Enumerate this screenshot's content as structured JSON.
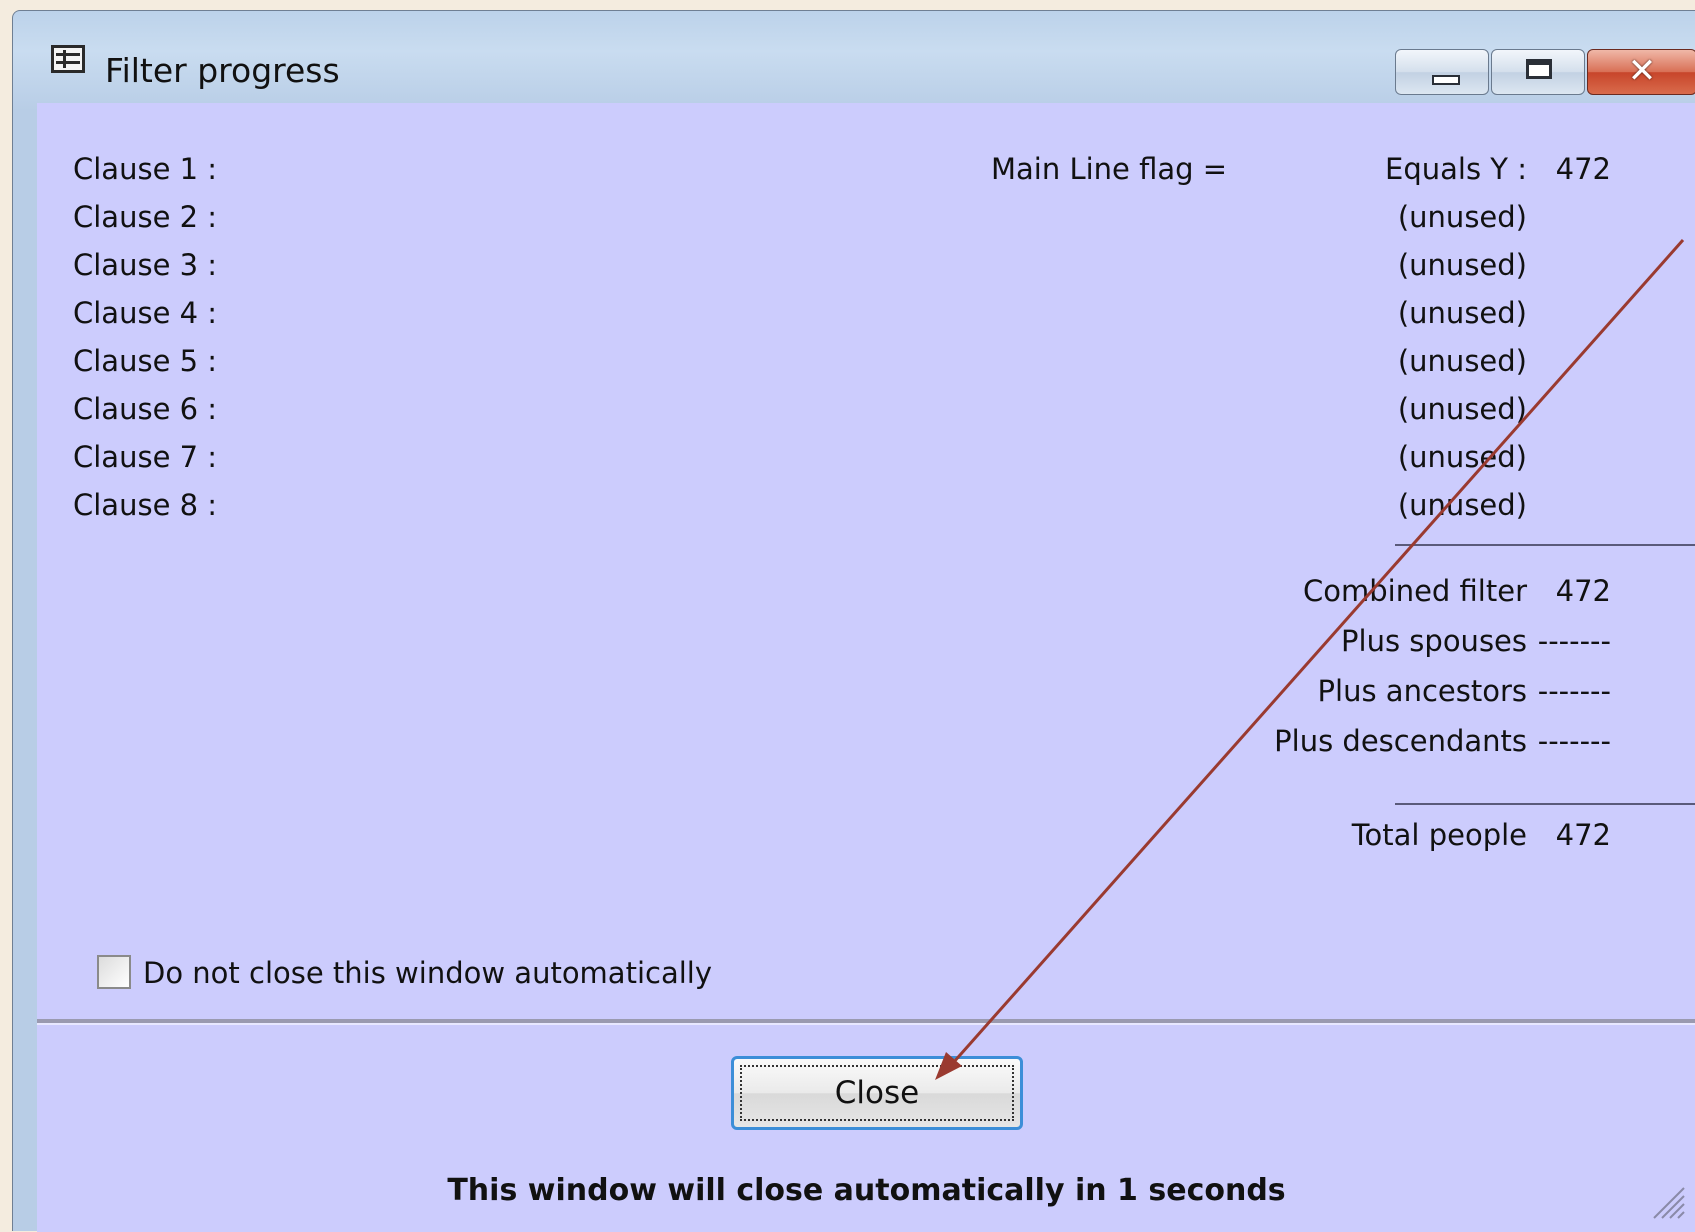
{
  "window": {
    "title": "Filter progress",
    "icon": "filter-window-icon",
    "controls": [
      "minimize-icon",
      "maximize-icon",
      "close-icon"
    ]
  },
  "clauses": [
    {
      "label": "Clause 1 :",
      "field": "Main Line flag =",
      "value": "Equals Y :",
      "count": "472"
    },
    {
      "label": "Clause 2 :",
      "field": "",
      "value": "(unused)",
      "count": ""
    },
    {
      "label": "Clause 3 :",
      "field": "",
      "value": "(unused)",
      "count": ""
    },
    {
      "label": "Clause 4 :",
      "field": "",
      "value": "(unused)",
      "count": ""
    },
    {
      "label": "Clause 5 :",
      "field": "",
      "value": "(unused)",
      "count": ""
    },
    {
      "label": "Clause 6 :",
      "field": "",
      "value": "(unused)",
      "count": ""
    },
    {
      "label": "Clause 7 :",
      "field": "",
      "value": "(unused)",
      "count": ""
    },
    {
      "label": "Clause 8 :",
      "field": "",
      "value": "(unused)",
      "count": ""
    }
  ],
  "summary": {
    "combined_filter": {
      "label": "Combined filter",
      "value": "472"
    },
    "plus_spouses": {
      "label": "Plus spouses",
      "value": "-------"
    },
    "plus_ancestors": {
      "label": "Plus ancestors",
      "value": "-------"
    },
    "plus_descendants": {
      "label": "Plus descendants",
      "value": "-------"
    },
    "total_people": {
      "label": "Total people",
      "value": "472"
    }
  },
  "options": {
    "do_not_close_label": "Do not close this window automatically",
    "do_not_close_checked": false
  },
  "footer": {
    "close_button_label": "Close",
    "auto_close_message": "This window will close automatically in 1 seconds"
  },
  "annotation": {
    "arrow_color": "#9a3a30"
  }
}
